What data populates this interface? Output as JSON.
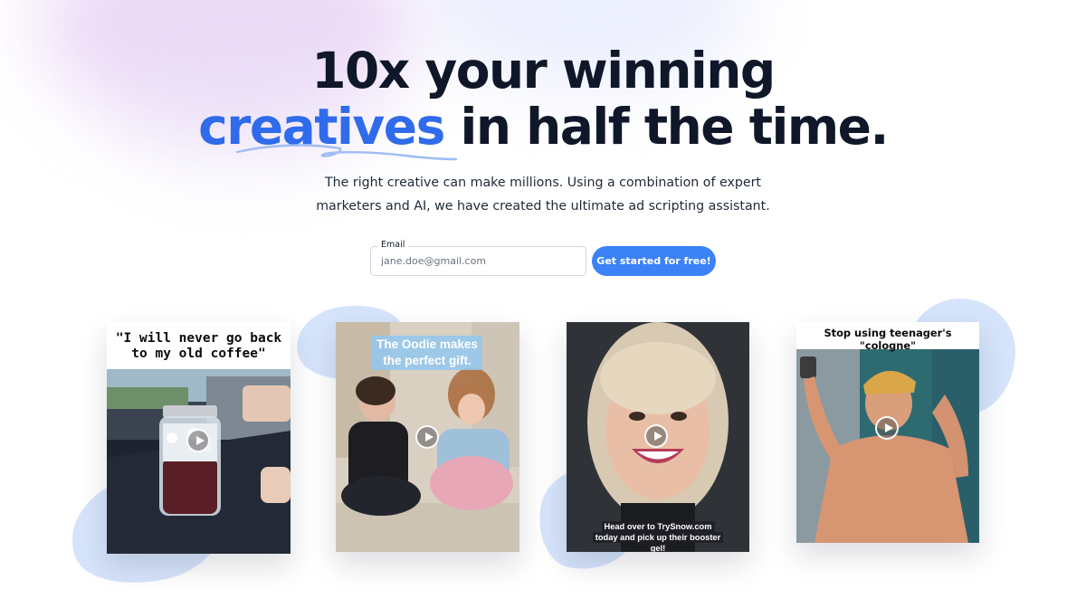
{
  "headline": {
    "line1": "10x your winning",
    "accent_word": "creatives",
    "line2_rest": " in half the time."
  },
  "subheadline": {
    "line1": "The right creative can make millions. Using a combination of expert",
    "line2": "marketers and AI, we have created the ultimate ad scripting assistant."
  },
  "signup": {
    "email_label": "Email",
    "email_placeholder": "jane.doe@gmail.com",
    "cta_label": "Get started for free!"
  },
  "videos": [
    {
      "caption": "\"I will never go back to my old coffee\""
    },
    {
      "caption": "The Oodie makes the perfect gift."
    },
    {
      "caption": "Head over to TrySnow.com today and pick up their booster gel!"
    },
    {
      "caption": "Stop using teenager's \"cologne\""
    }
  ],
  "colors": {
    "accent": "#2f6bea",
    "cta_background": "#3b82f6",
    "blob": "#d6e4fb",
    "text": "#0f1729"
  },
  "icons": [
    "play-icon"
  ]
}
